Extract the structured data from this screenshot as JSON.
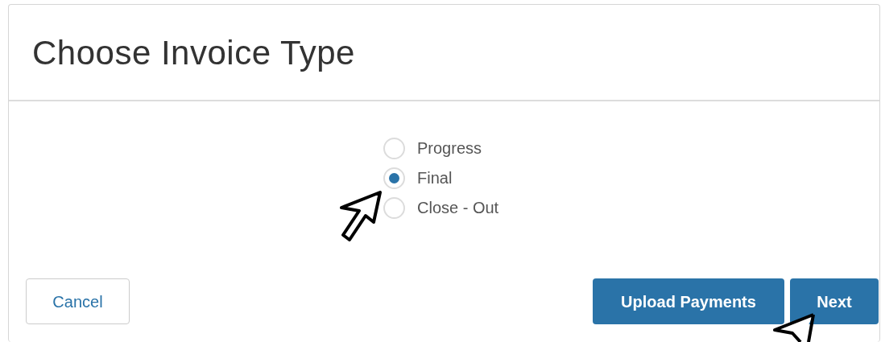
{
  "dialog": {
    "title": "Choose Invoice Type"
  },
  "options": [
    {
      "label": "Progress",
      "selected": false
    },
    {
      "label": "Final",
      "selected": true
    },
    {
      "label": "Close - Out",
      "selected": false
    }
  ],
  "buttons": [
    {
      "label": "Cancel",
      "kind": "secondary"
    },
    {
      "label": "Upload Payments",
      "kind": "primary"
    },
    {
      "label": "Next",
      "kind": "primary"
    }
  ]
}
